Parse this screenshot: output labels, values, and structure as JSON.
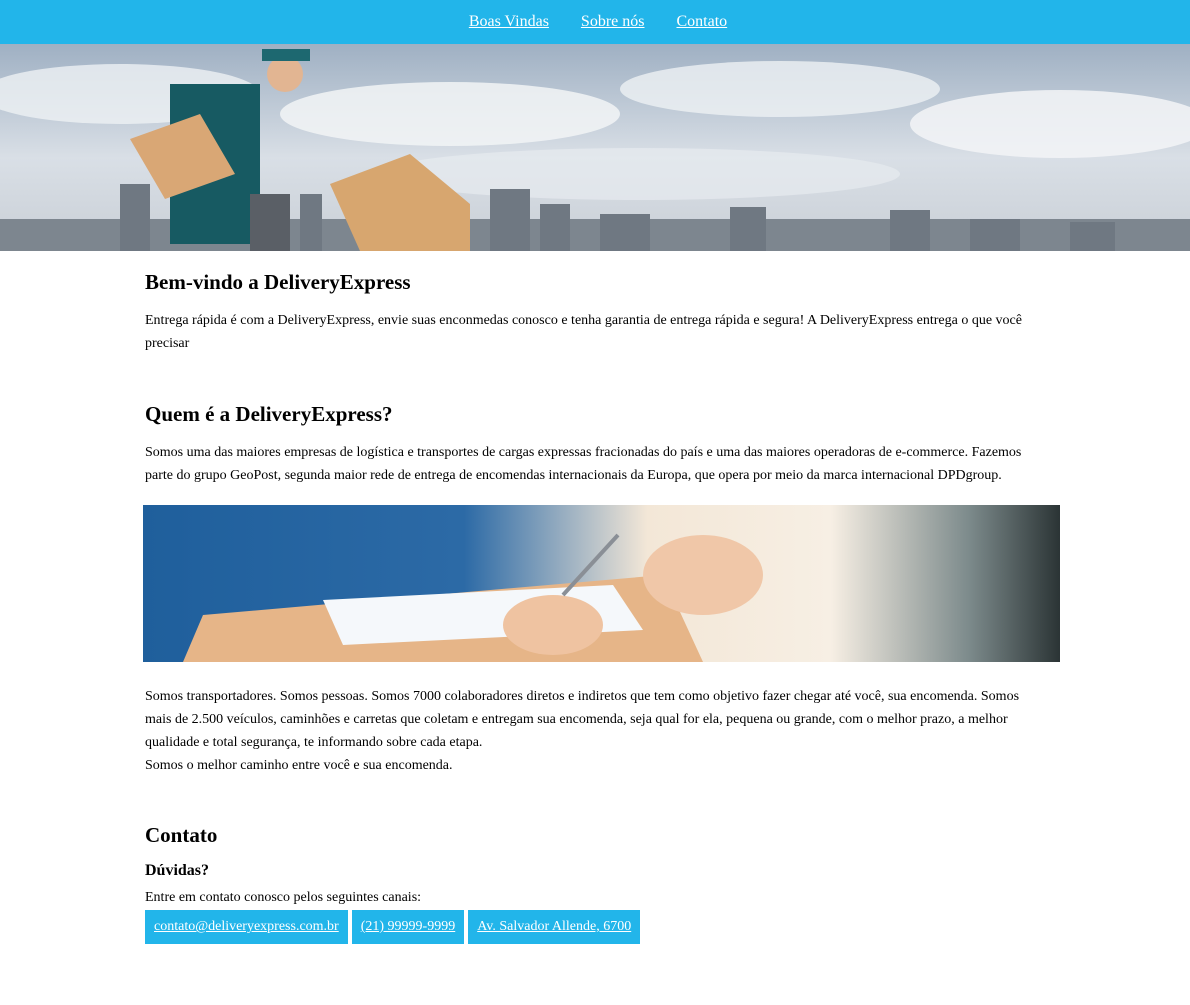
{
  "nav": {
    "items": [
      {
        "label": "Boas Vindas"
      },
      {
        "label": "Sobre nós"
      },
      {
        "label": "Contato"
      }
    ]
  },
  "welcome": {
    "title": "Bem-vindo a DeliveryExpress",
    "text": "Entrega rápida é com a DeliveryExpress, envie suas enconmedas conosco e tenha garantia de entrega rápida e segura! A DeliveryExpress entrega o que você precisar"
  },
  "about": {
    "title": "Quem é a DeliveryExpress?",
    "text": "Somos uma das maiores empresas de logística e transportes de cargas expressas fracionadas do país e uma das maiores operadoras de e-commerce. Fazemos parte do grupo GeoPost, segunda maior rede de entrega de encomendas internacionais da Europa, que opera por meio da marca internacional DPDgroup.",
    "text2_line1": "Somos transportadores. Somos pessoas. Somos 7000 colaboradores diretos e indiretos que tem como objetivo fazer chegar até você, sua encomenda. Somos mais de 2.500 veículos, caminhões e carretas que coletam e entregam sua encomenda, seja qual for ela, pequena ou grande, com o melhor prazo, a melhor qualidade e total segurança, te informando sobre cada etapa.",
    "text2_line2": "Somos o melhor caminho entre você e sua encomenda."
  },
  "contact": {
    "title": "Contato",
    "subtitle": "Dúvidas?",
    "lead": "Entre em contato conosco pelos seguintes canais:",
    "email": "contato@deliveryexpress.com.br",
    "phone": "(21) 99999-9999",
    "address": "Av. Salvador Allende, 6700"
  },
  "colors": {
    "accent": "#22b5ea"
  }
}
